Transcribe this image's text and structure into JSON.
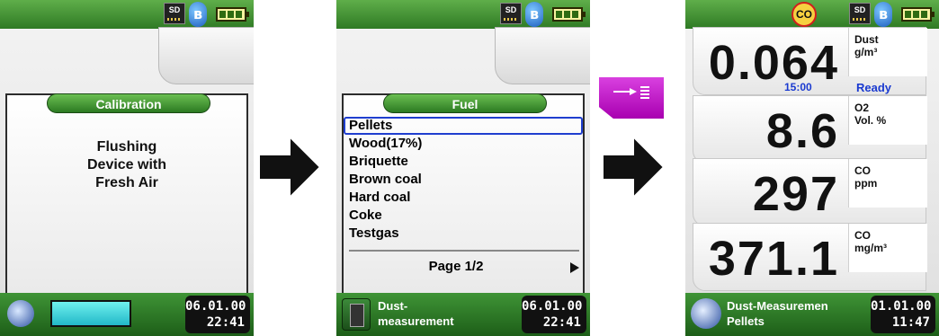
{
  "screens": {
    "calibration": {
      "title": "Calibration",
      "message_line1": "Flushing",
      "message_line2": "Device with",
      "message_line3": "Fresh Air",
      "progress": 1.0,
      "date": "06.01.00",
      "time": "22:41"
    },
    "fuel": {
      "title": "Fuel",
      "items": [
        "Pellets",
        "Wood(17%)",
        "Briquette",
        "Brown coal",
        "Hard coal",
        "Coke",
        "Testgas"
      ],
      "selected_index": 0,
      "page_label": "Page 1/2",
      "status_line1": "Dust-",
      "status_line2": "measurement",
      "date": "06.01.00",
      "time": "22:41"
    },
    "measurement": {
      "readings": [
        {
          "value": "0.064",
          "label": "Dust",
          "unit": "g/m³"
        },
        {
          "value": "8.6",
          "label": "O2",
          "unit": "Vol. %"
        },
        {
          "value": "297",
          "label": "CO",
          "unit": "ppm"
        },
        {
          "value": "371.1",
          "label": "CO",
          "unit": "mg/m³"
        }
      ],
      "timer": "15:00",
      "ready": "Ready",
      "co_indicator": "CO",
      "status_line1": "Dust-Measuremen",
      "status_line2": "Pellets",
      "date": "01.01.00",
      "time": "11:47"
    }
  },
  "status_icons": {
    "sd_label": "SD",
    "bluetooth": "bluetooth-icon",
    "battery": "battery-icon"
  },
  "colors": {
    "accent_green": "#2f7a24",
    "selection_blue": "#1f3ecf",
    "key_magenta": "#c21fc8",
    "ready_blue": "#1a3ad0"
  }
}
